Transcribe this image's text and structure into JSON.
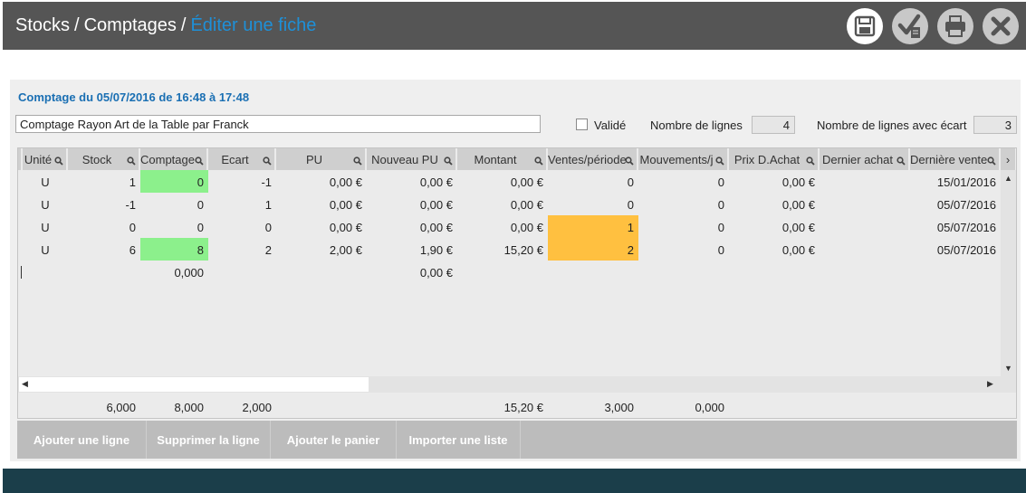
{
  "header": {
    "crumbs": [
      "Stocks",
      "Comptages"
    ],
    "separator": "/",
    "current": "Éditer une fiche",
    "buttons": [
      {
        "name": "save-button",
        "icon": "floppy-disk-icon"
      },
      {
        "name": "validate-button",
        "icon": "checkmark-document-icon"
      },
      {
        "name": "print-button",
        "icon": "printer-icon"
      },
      {
        "name": "close-button",
        "icon": "close-icon"
      }
    ]
  },
  "form": {
    "title": "Comptage du 05/07/2016 de 16:48 à 17:48",
    "name_value": "Comptage Rayon Art de la Table par Franck",
    "valide_label": "Validé",
    "valide_checked": false,
    "nb_lignes_label": "Nombre de lignes",
    "nb_lignes_value": "4",
    "nb_ecart_label": "Nombre de lignes avec écart",
    "nb_ecart_value": "3"
  },
  "grid": {
    "columns": [
      "Unité",
      "Stock",
      "Comptage",
      "Ecart",
      "PU",
      "Nouveau PU",
      "Montant",
      "Ventes/période",
      "Mouvements/j",
      "Prix D.Achat",
      "Dernier achat",
      "Dernière vente"
    ],
    "rows": [
      {
        "cells": [
          "U",
          "1",
          "0",
          "-1",
          "0,00 €",
          "0,00 €",
          "0,00 €",
          "0",
          "0",
          "0,00 €",
          "",
          "15/01/2016"
        ],
        "highlight": [
          "",
          "",
          "green",
          "",
          "",
          "",
          "",
          "",
          "",
          "",
          "",
          ""
        ]
      },
      {
        "cells": [
          "U",
          "-1",
          "0",
          "1",
          "0,00 €",
          "0,00 €",
          "0,00 €",
          "0",
          "0",
          "0,00 €",
          "",
          "05/07/2016"
        ],
        "highlight": [
          "",
          "",
          "",
          "",
          "",
          "",
          "",
          "",
          "",
          "",
          "",
          ""
        ]
      },
      {
        "cells": [
          "U",
          "0",
          "0",
          "0",
          "0,00 €",
          "0,00 €",
          "0,00 €",
          "1",
          "0",
          "0,00 €",
          "",
          "05/07/2016"
        ],
        "highlight": [
          "",
          "",
          "",
          "",
          "",
          "",
          "",
          "orange",
          "",
          "",
          "",
          ""
        ]
      },
      {
        "cells": [
          "U",
          "6",
          "8",
          "2",
          "2,00 €",
          "1,90 €",
          "15,20 €",
          "2",
          "0",
          "0,00 €",
          "",
          "05/07/2016"
        ],
        "highlight": [
          "",
          "",
          "green",
          "",
          "",
          "",
          "",
          "orange",
          "",
          "",
          "",
          ""
        ]
      },
      {
        "cells": [
          "",
          "",
          "0,000",
          "",
          "",
          "0,00 €",
          "",
          "",
          "",
          "",
          "",
          ""
        ],
        "highlight": [
          "",
          "",
          "",
          "",
          "",
          "",
          "",
          "",
          "",
          "",
          "",
          ""
        ]
      }
    ],
    "totals": [
      "",
      "6,000",
      "8,000",
      "2,000",
      "",
      "",
      "15,20 €",
      "3,000",
      "0,000",
      "",
      "",
      ""
    ]
  },
  "actions": {
    "add_line": "Ajouter une ligne",
    "delete_line": "Supprimer la ligne",
    "add_cart": "Ajouter le panier",
    "import_list": "Importer une liste"
  },
  "colors": {
    "titlebar": "#555555",
    "accent": "#1a6fb3",
    "highlight_green": "#8cf08c",
    "highlight_orange": "#ffc040",
    "bottom_bar": "#1b3e4a"
  }
}
